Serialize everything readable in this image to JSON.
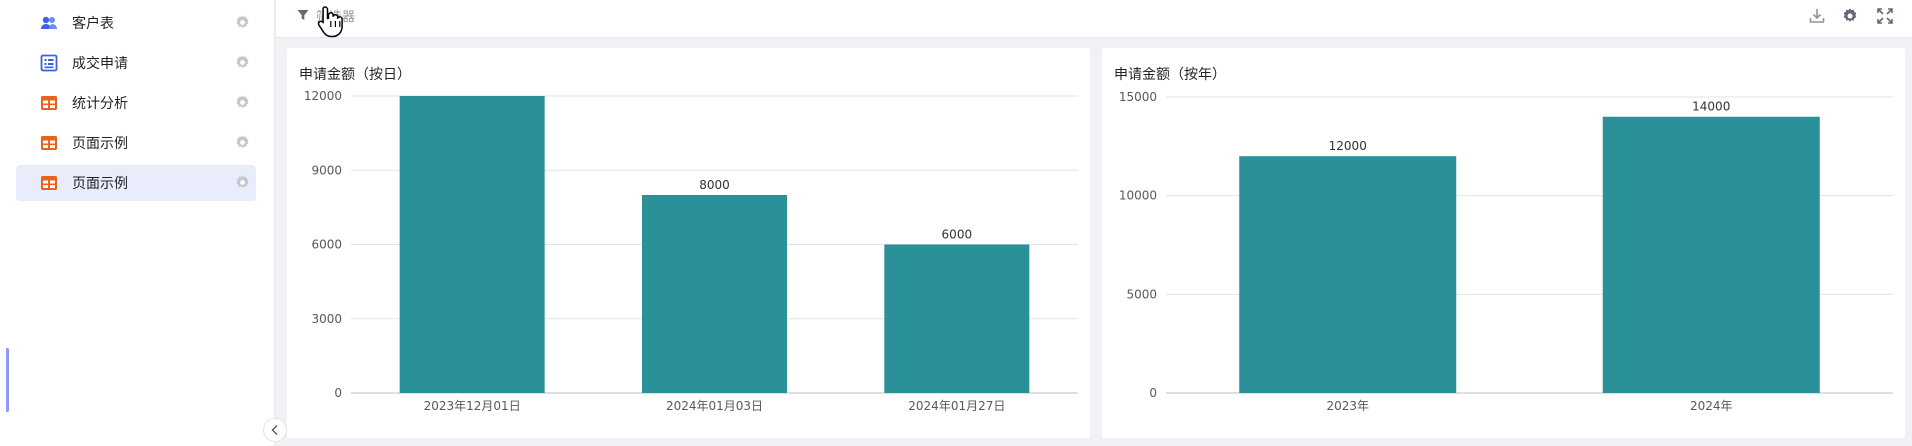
{
  "sidebar": {
    "items": [
      {
        "label": "客户表",
        "icon": "users-icon",
        "active": false
      },
      {
        "label": "成交申请",
        "icon": "form-icon",
        "active": false
      },
      {
        "label": "统计分析",
        "icon": "table-icon",
        "active": false
      },
      {
        "label": "页面示例",
        "icon": "table-icon",
        "active": false
      },
      {
        "label": "页面示例",
        "icon": "table-icon",
        "active": true
      }
    ]
  },
  "topbar": {
    "filter_label": "筛选器",
    "tools": [
      "download-icon",
      "settings-icon",
      "fullscreen-icon"
    ]
  },
  "colors": {
    "bar": "#2a9198",
    "accent_active": "#e9ecfb"
  },
  "chart_data": [
    {
      "type": "bar",
      "title": "申请金额（按日）",
      "categories": [
        "2023年12月01日",
        "2024年01月03日",
        "2024年01月27日"
      ],
      "values": [
        12000,
        8000,
        6000
      ],
      "data_labels": [
        "",
        "8000",
        "6000"
      ],
      "yticks": [
        0,
        3000,
        6000,
        9000,
        12000
      ],
      "ylim": [
        0,
        12000
      ],
      "grid": true
    },
    {
      "type": "bar",
      "title": "申请金额（按年）",
      "categories": [
        "2023年",
        "2024年"
      ],
      "values": [
        12000,
        14000
      ],
      "data_labels": [
        "12000",
        "14000"
      ],
      "yticks": [
        0,
        5000,
        10000,
        15000
      ],
      "ylim": [
        0,
        15000
      ],
      "grid": true
    }
  ]
}
